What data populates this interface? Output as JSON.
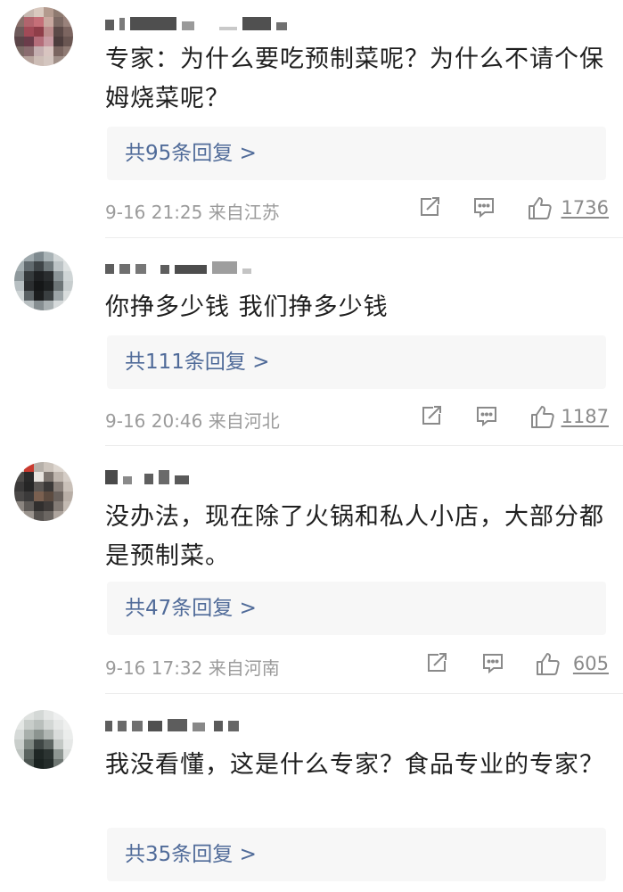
{
  "comments": [
    {
      "text": "专家：为什么要吃预制菜呢？为什么不请个保姆烧菜呢？",
      "replies": "共95条回复 >",
      "time": "9-16 21:25  来自江苏",
      "likes": "1736"
    },
    {
      "text": "你挣多少钱 我们挣多少钱",
      "replies": "共111条回复 >",
      "time": "9-16 20:46  来自河北",
      "likes": "1187"
    },
    {
      "text": "没办法，现在除了火锅和私人小店，大部分都是预制菜。",
      "replies": "共47条回复 >",
      "time": "9-16 17:32  来自河南",
      "likes": "605"
    },
    {
      "text": "我没看懂，这是什么专家？食品专业的专家？",
      "replies": "共35条回复 >"
    }
  ],
  "colors": {
    "reply_link": "#506b99",
    "meta_gray": "#9b9b9b",
    "reply_bg": "#f7f7f7"
  },
  "icons": [
    "share-icon",
    "comment-icon",
    "thumbs-up-icon"
  ]
}
